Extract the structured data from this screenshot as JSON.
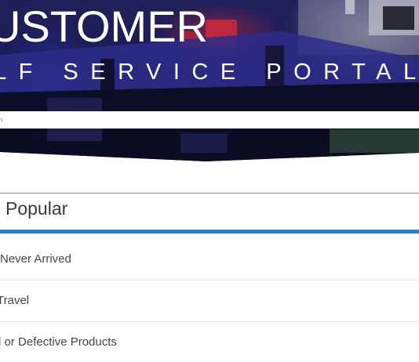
{
  "hero": {
    "title": "USTOMER",
    "subtitle": "LF SERVICE PORTAL",
    "background_color": "#1a1a55"
  },
  "search": {
    "placeholder": "arch",
    "value": ""
  },
  "popular": {
    "heading": "Popular",
    "accent_color": "#2c7fc6",
    "items": [
      {
        "label": "Never Arrived"
      },
      {
        "label": "Travel"
      },
      {
        "label": "d or Defective Products"
      }
    ]
  }
}
